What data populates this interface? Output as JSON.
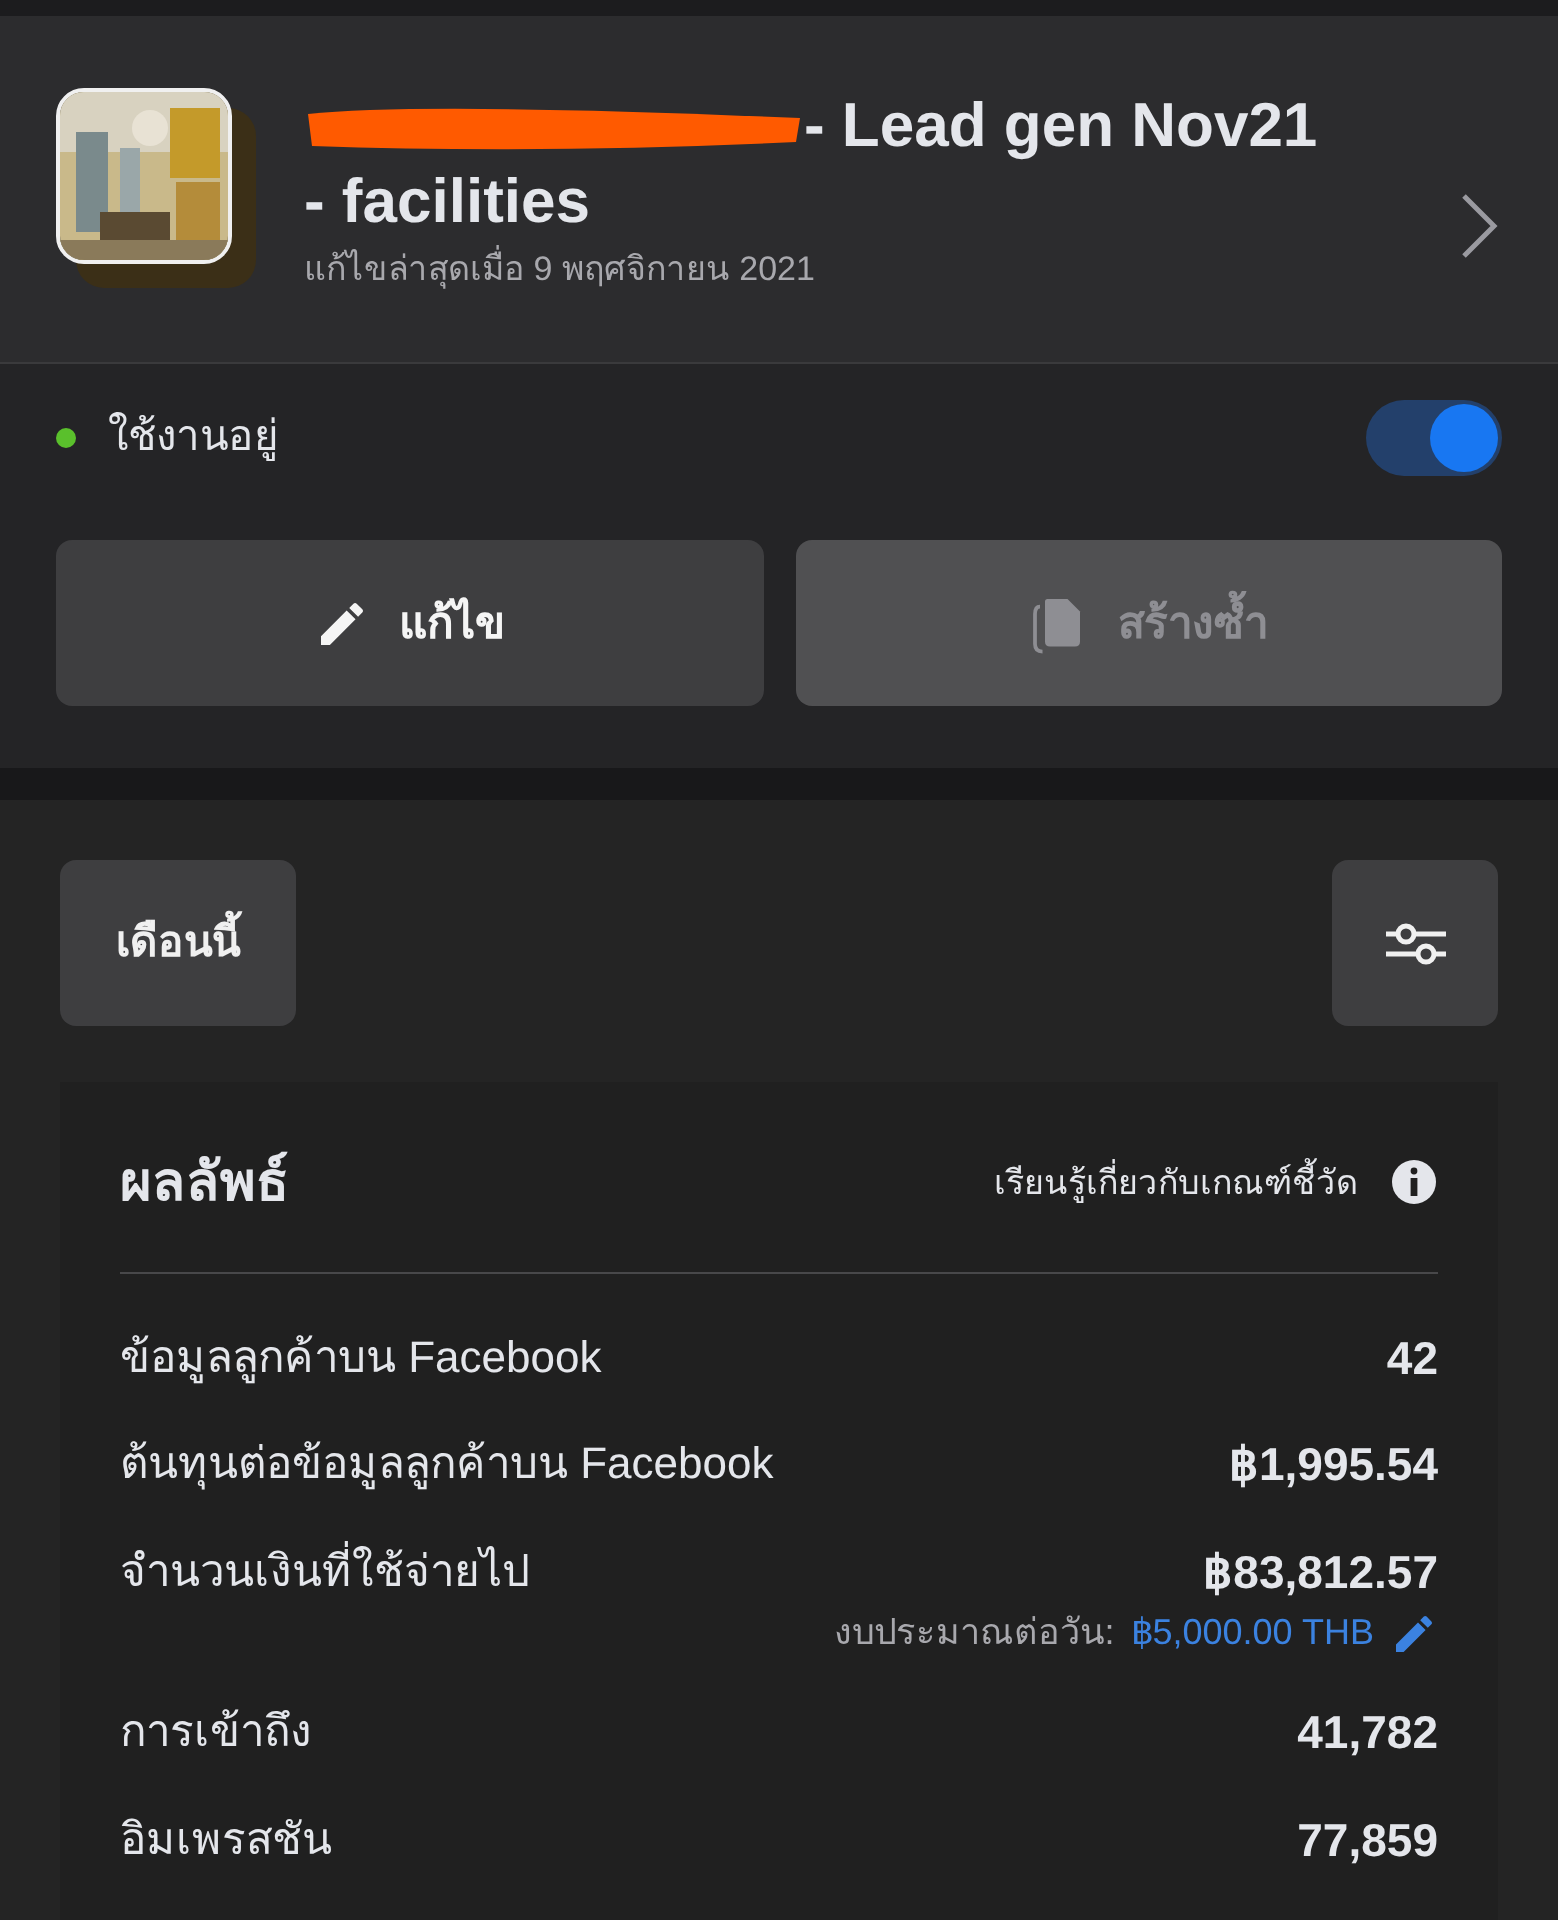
{
  "campaign": {
    "title_redacted": true,
    "title_lines": [
      "- Lead gen Nov21",
      "- facilities"
    ],
    "edited": "แก้ไขล่าสุดเมื่อ 9 พฤศจิกายน 2021"
  },
  "status": {
    "label": "ใช้งานอยู่",
    "color": "#5ac02c",
    "on": true
  },
  "actions": [
    {
      "kind": "edit",
      "label": "แก้ไข",
      "disabled": false
    },
    {
      "kind": "duplicate",
      "label": "สร้างซ้ำ",
      "disabled": true
    }
  ],
  "period": {
    "label": "เดือนนี้"
  },
  "results": {
    "title": "ผลลัพธ์",
    "learn_more": "เรียนรู้เกี่ยวกับเกณฑ์ชี้วัด",
    "metrics": [
      {
        "label": "ข้อมูลลูกค้าบน Facebook",
        "value": "42"
      },
      {
        "label": "ต้นทุนต่อข้อมูลลูกค้าบน Facebook",
        "value": "฿1,995.54"
      },
      {
        "label": "จำนวนเงินที่ใช้จ่ายไป",
        "value": "฿83,812.57",
        "note_label": "งบประมาณต่อวัน:",
        "note_value": "฿5,000.00 THB"
      },
      {
        "label": "การเข้าถึง",
        "value": "41,782"
      },
      {
        "label": "อิมเพรสชัน",
        "value": "77,859"
      }
    ]
  }
}
